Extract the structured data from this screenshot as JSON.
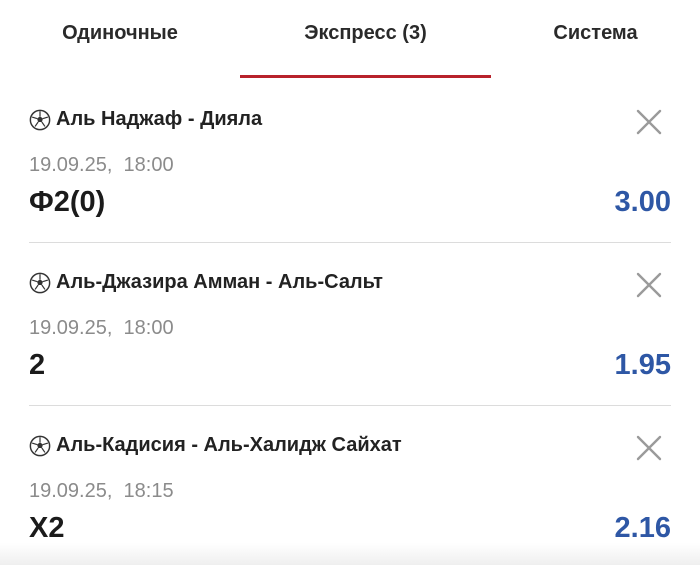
{
  "tabs": [
    {
      "label": "Одиночные",
      "active": false
    },
    {
      "label": "Экспресс (3)",
      "active": true
    },
    {
      "label": "Система",
      "active": false
    }
  ],
  "colors": {
    "active_tab_underline": "#b8222b",
    "odds": "#2e57a5",
    "date": "#8b8b8b"
  },
  "bets": [
    {
      "sport_icon": "soccer-ball-icon",
      "match": "Аль Наджаф - Дияла",
      "date": "19.09.25,  18:00",
      "outcome": "Ф2(0)",
      "odds": "3.00"
    },
    {
      "sport_icon": "soccer-ball-icon",
      "match": "Аль-Джазира Амман - Аль-Сальт",
      "date": "19.09.25,  18:00",
      "outcome": "2",
      "odds": "1.95"
    },
    {
      "sport_icon": "soccer-ball-icon",
      "match": "Аль-Кадисия - Аль-Халидж Сайхат",
      "date": "19.09.25,  18:15",
      "outcome": "Х2",
      "odds": "2.16"
    }
  ]
}
